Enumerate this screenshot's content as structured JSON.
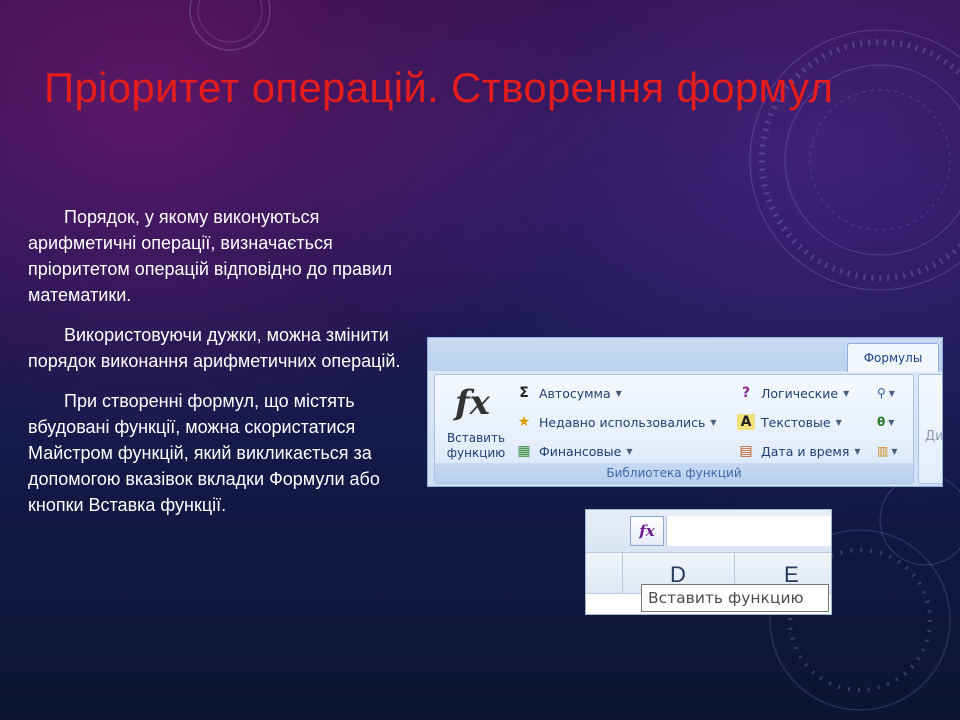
{
  "slide": {
    "title": "Пріоритет операцій. Створення формул",
    "paragraphs": [
      "Порядок, у якому виконуються арифметичні операції, визначається пріоритетом операцій відповідно до правил математики.",
      "Використовуючи дужки, можна змінити порядок виконання арифметичних операцій.",
      "При створенні формул, що містять вбудовані функції, можна скористатися Майстром функцій, який викликається за допомогою вказівок вкладки Формули або кнопки Вставка функції."
    ]
  },
  "ribbon": {
    "tab_label": "Формулы",
    "insert_function_label": "Вставить функцию",
    "fx_symbol": "fx",
    "items": [
      {
        "label": "Автосумма",
        "icon": "sigma-icon",
        "glyph": "Σ"
      },
      {
        "label": "Недавно использовались",
        "icon": "star-icon",
        "glyph": "★"
      },
      {
        "label": "Финансовые",
        "icon": "finance-icon",
        "glyph": "▦"
      },
      {
        "label": "Логические",
        "icon": "question-book-icon",
        "glyph": "?"
      },
      {
        "label": "Текстовые",
        "icon": "text-a-icon",
        "glyph": "A"
      },
      {
        "label": "Дата и время",
        "icon": "calendar-icon",
        "glyph": "▤"
      }
    ],
    "mini_icons": [
      {
        "icon": "lookup-magnifier-icon",
        "glyph": "🔍"
      },
      {
        "icon": "math-theta-icon",
        "glyph": "θ"
      },
      {
        "icon": "more-functions-icon",
        "glyph": "▥"
      }
    ],
    "group_label": "Библиотека функций",
    "next_group_partial": "Ди"
  },
  "formula_bar": {
    "fx_symbol": "fx",
    "columns": [
      "D",
      "E"
    ],
    "tooltip": "Вставить функцию"
  },
  "colors": {
    "title": "#e51c1c",
    "text": "#ffffff",
    "ribbon_text": "#1f3f73"
  }
}
